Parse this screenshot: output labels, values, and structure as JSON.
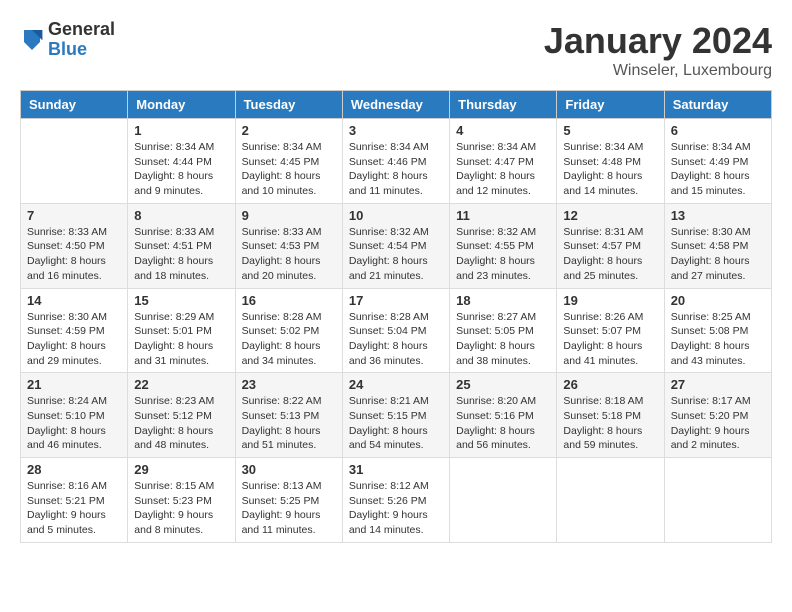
{
  "logo": {
    "general": "General",
    "blue": "Blue"
  },
  "title": {
    "month_year": "January 2024",
    "location": "Winseler, Luxembourg"
  },
  "days_of_week": [
    "Sunday",
    "Monday",
    "Tuesday",
    "Wednesday",
    "Thursday",
    "Friday",
    "Saturday"
  ],
  "weeks": [
    [
      {
        "day": "",
        "sunrise": "",
        "sunset": "",
        "daylight": ""
      },
      {
        "day": "1",
        "sunrise": "Sunrise: 8:34 AM",
        "sunset": "Sunset: 4:44 PM",
        "daylight": "Daylight: 8 hours and 9 minutes."
      },
      {
        "day": "2",
        "sunrise": "Sunrise: 8:34 AM",
        "sunset": "Sunset: 4:45 PM",
        "daylight": "Daylight: 8 hours and 10 minutes."
      },
      {
        "day": "3",
        "sunrise": "Sunrise: 8:34 AM",
        "sunset": "Sunset: 4:46 PM",
        "daylight": "Daylight: 8 hours and 11 minutes."
      },
      {
        "day": "4",
        "sunrise": "Sunrise: 8:34 AM",
        "sunset": "Sunset: 4:47 PM",
        "daylight": "Daylight: 8 hours and 12 minutes."
      },
      {
        "day": "5",
        "sunrise": "Sunrise: 8:34 AM",
        "sunset": "Sunset: 4:48 PM",
        "daylight": "Daylight: 8 hours and 14 minutes."
      },
      {
        "day": "6",
        "sunrise": "Sunrise: 8:34 AM",
        "sunset": "Sunset: 4:49 PM",
        "daylight": "Daylight: 8 hours and 15 minutes."
      }
    ],
    [
      {
        "day": "7",
        "sunrise": "Sunrise: 8:33 AM",
        "sunset": "Sunset: 4:50 PM",
        "daylight": "Daylight: 8 hours and 16 minutes."
      },
      {
        "day": "8",
        "sunrise": "Sunrise: 8:33 AM",
        "sunset": "Sunset: 4:51 PM",
        "daylight": "Daylight: 8 hours and 18 minutes."
      },
      {
        "day": "9",
        "sunrise": "Sunrise: 8:33 AM",
        "sunset": "Sunset: 4:53 PM",
        "daylight": "Daylight: 8 hours and 20 minutes."
      },
      {
        "day": "10",
        "sunrise": "Sunrise: 8:32 AM",
        "sunset": "Sunset: 4:54 PM",
        "daylight": "Daylight: 8 hours and 21 minutes."
      },
      {
        "day": "11",
        "sunrise": "Sunrise: 8:32 AM",
        "sunset": "Sunset: 4:55 PM",
        "daylight": "Daylight: 8 hours and 23 minutes."
      },
      {
        "day": "12",
        "sunrise": "Sunrise: 8:31 AM",
        "sunset": "Sunset: 4:57 PM",
        "daylight": "Daylight: 8 hours and 25 minutes."
      },
      {
        "day": "13",
        "sunrise": "Sunrise: 8:30 AM",
        "sunset": "Sunset: 4:58 PM",
        "daylight": "Daylight: 8 hours and 27 minutes."
      }
    ],
    [
      {
        "day": "14",
        "sunrise": "Sunrise: 8:30 AM",
        "sunset": "Sunset: 4:59 PM",
        "daylight": "Daylight: 8 hours and 29 minutes."
      },
      {
        "day": "15",
        "sunrise": "Sunrise: 8:29 AM",
        "sunset": "Sunset: 5:01 PM",
        "daylight": "Daylight: 8 hours and 31 minutes."
      },
      {
        "day": "16",
        "sunrise": "Sunrise: 8:28 AM",
        "sunset": "Sunset: 5:02 PM",
        "daylight": "Daylight: 8 hours and 34 minutes."
      },
      {
        "day": "17",
        "sunrise": "Sunrise: 8:28 AM",
        "sunset": "Sunset: 5:04 PM",
        "daylight": "Daylight: 8 hours and 36 minutes."
      },
      {
        "day": "18",
        "sunrise": "Sunrise: 8:27 AM",
        "sunset": "Sunset: 5:05 PM",
        "daylight": "Daylight: 8 hours and 38 minutes."
      },
      {
        "day": "19",
        "sunrise": "Sunrise: 8:26 AM",
        "sunset": "Sunset: 5:07 PM",
        "daylight": "Daylight: 8 hours and 41 minutes."
      },
      {
        "day": "20",
        "sunrise": "Sunrise: 8:25 AM",
        "sunset": "Sunset: 5:08 PM",
        "daylight": "Daylight: 8 hours and 43 minutes."
      }
    ],
    [
      {
        "day": "21",
        "sunrise": "Sunrise: 8:24 AM",
        "sunset": "Sunset: 5:10 PM",
        "daylight": "Daylight: 8 hours and 46 minutes."
      },
      {
        "day": "22",
        "sunrise": "Sunrise: 8:23 AM",
        "sunset": "Sunset: 5:12 PM",
        "daylight": "Daylight: 8 hours and 48 minutes."
      },
      {
        "day": "23",
        "sunrise": "Sunrise: 8:22 AM",
        "sunset": "Sunset: 5:13 PM",
        "daylight": "Daylight: 8 hours and 51 minutes."
      },
      {
        "day": "24",
        "sunrise": "Sunrise: 8:21 AM",
        "sunset": "Sunset: 5:15 PM",
        "daylight": "Daylight: 8 hours and 54 minutes."
      },
      {
        "day": "25",
        "sunrise": "Sunrise: 8:20 AM",
        "sunset": "Sunset: 5:16 PM",
        "daylight": "Daylight: 8 hours and 56 minutes."
      },
      {
        "day": "26",
        "sunrise": "Sunrise: 8:18 AM",
        "sunset": "Sunset: 5:18 PM",
        "daylight": "Daylight: 8 hours and 59 minutes."
      },
      {
        "day": "27",
        "sunrise": "Sunrise: 8:17 AM",
        "sunset": "Sunset: 5:20 PM",
        "daylight": "Daylight: 9 hours and 2 minutes."
      }
    ],
    [
      {
        "day": "28",
        "sunrise": "Sunrise: 8:16 AM",
        "sunset": "Sunset: 5:21 PM",
        "daylight": "Daylight: 9 hours and 5 minutes."
      },
      {
        "day": "29",
        "sunrise": "Sunrise: 8:15 AM",
        "sunset": "Sunset: 5:23 PM",
        "daylight": "Daylight: 9 hours and 8 minutes."
      },
      {
        "day": "30",
        "sunrise": "Sunrise: 8:13 AM",
        "sunset": "Sunset: 5:25 PM",
        "daylight": "Daylight: 9 hours and 11 minutes."
      },
      {
        "day": "31",
        "sunrise": "Sunrise: 8:12 AM",
        "sunset": "Sunset: 5:26 PM",
        "daylight": "Daylight: 9 hours and 14 minutes."
      },
      {
        "day": "",
        "sunrise": "",
        "sunset": "",
        "daylight": ""
      },
      {
        "day": "",
        "sunrise": "",
        "sunset": "",
        "daylight": ""
      },
      {
        "day": "",
        "sunrise": "",
        "sunset": "",
        "daylight": ""
      }
    ]
  ],
  "colors": {
    "header_bg": "#2a7abf",
    "header_text": "#ffffff",
    "accent": "#2a7abf"
  }
}
